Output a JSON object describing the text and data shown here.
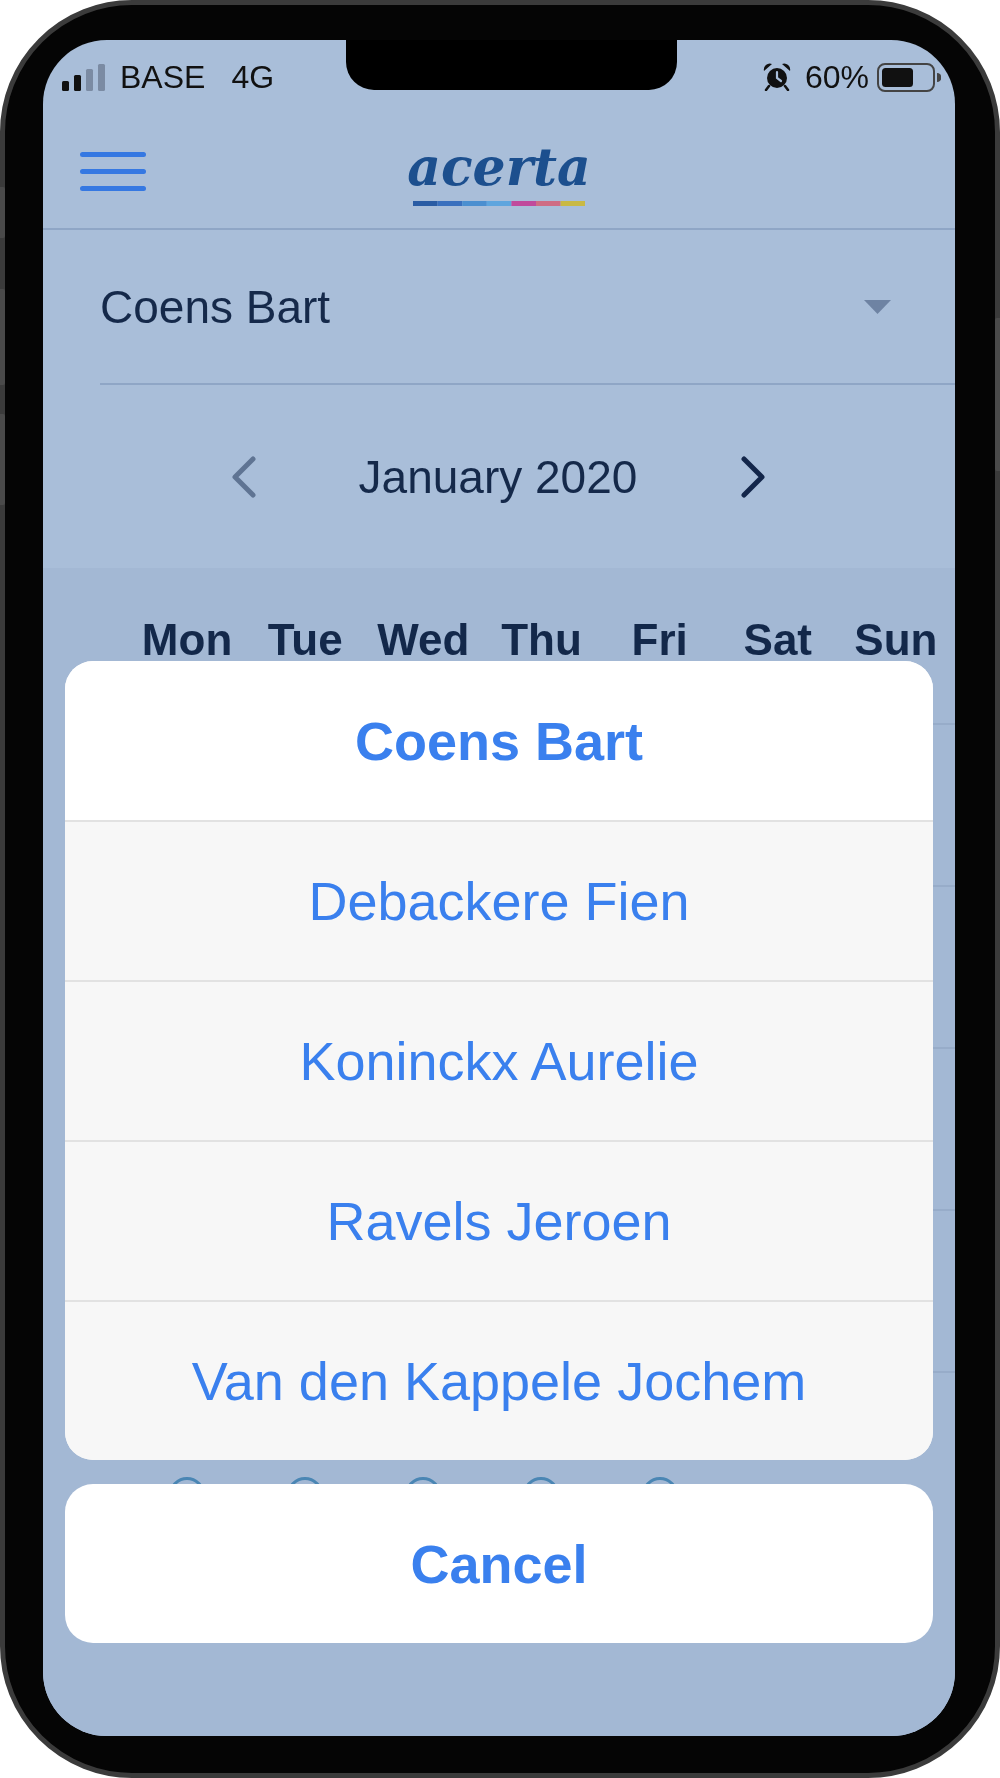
{
  "status_bar": {
    "carrier": "BASE",
    "network": "4G",
    "battery": "60%"
  },
  "header": {
    "logo": "acerta"
  },
  "employee_select": {
    "value": "Coens Bart"
  },
  "month_nav": {
    "previous_button": {
      "disabled": true
    },
    "label": "January 2020",
    "next_button": {
      "disabled": false
    }
  },
  "calendar": {
    "weekdays": [
      "Mon",
      "Tue",
      "Wed",
      "Thu",
      "Fri",
      "Sat",
      "Sun"
    ]
  },
  "action_sheet": {
    "options": [
      {
        "label": "Coens Bart",
        "selected": true
      },
      {
        "label": "Debackere Fien",
        "selected": false
      },
      {
        "label": "Koninckx Aurelie",
        "selected": false
      },
      {
        "label": "Ravels Jeroen",
        "selected": false
      },
      {
        "label": "Van den Kappele Jochem",
        "selected": false
      }
    ],
    "cancel": "Cancel"
  }
}
